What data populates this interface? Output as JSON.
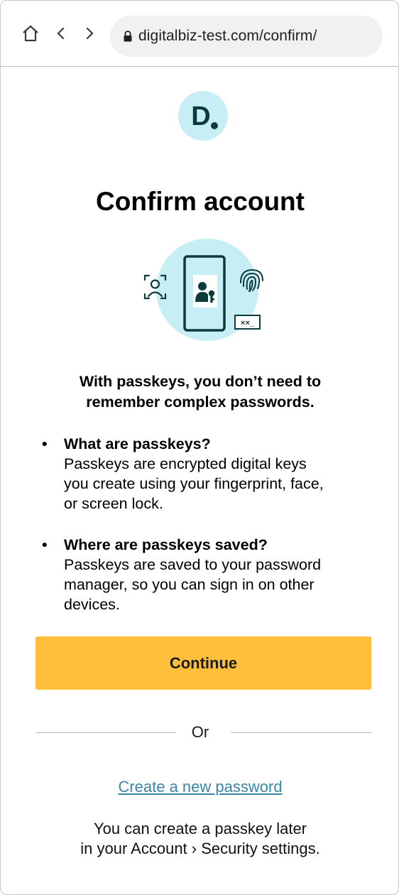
{
  "browser": {
    "url": "digitalbiz-test.com/confirm/",
    "icons": {
      "home": "home-icon",
      "back": "chevron-left-icon",
      "forward": "chevron-right-icon",
      "lock": "lock-icon"
    }
  },
  "brand": {
    "logo_letter": "D",
    "logo_bg": "#c6eef4",
    "logo_fg": "#0b3b3b"
  },
  "main": {
    "title": "Confirm account",
    "subtitle_line1": "With passkeys, you don’t need to",
    "subtitle_line2": "remember complex passwords.",
    "faq": [
      {
        "bullet": "•",
        "question": "What are passkeys?",
        "answer_lines": [
          "Passkeys are encrypted digital keys",
          "you create using your fingerprint, face,",
          "or screen lock."
        ]
      },
      {
        "bullet": "•",
        "question": "Where are passkeys saved?",
        "answer_lines": [
          "Passkeys are saved to your password",
          "manager, so you can sign in on other",
          "devices."
        ]
      }
    ],
    "continue_label": "Continue",
    "continue_color": "#ffbf3b",
    "or_label": "Or",
    "create_password_link": "Create a new password",
    "link_color": "#3a85a8",
    "later_line1": "You can create a passkey later",
    "later_line2": "in your Account › Security settings.",
    "illustration": {
      "password_field_text": "××_"
    }
  }
}
